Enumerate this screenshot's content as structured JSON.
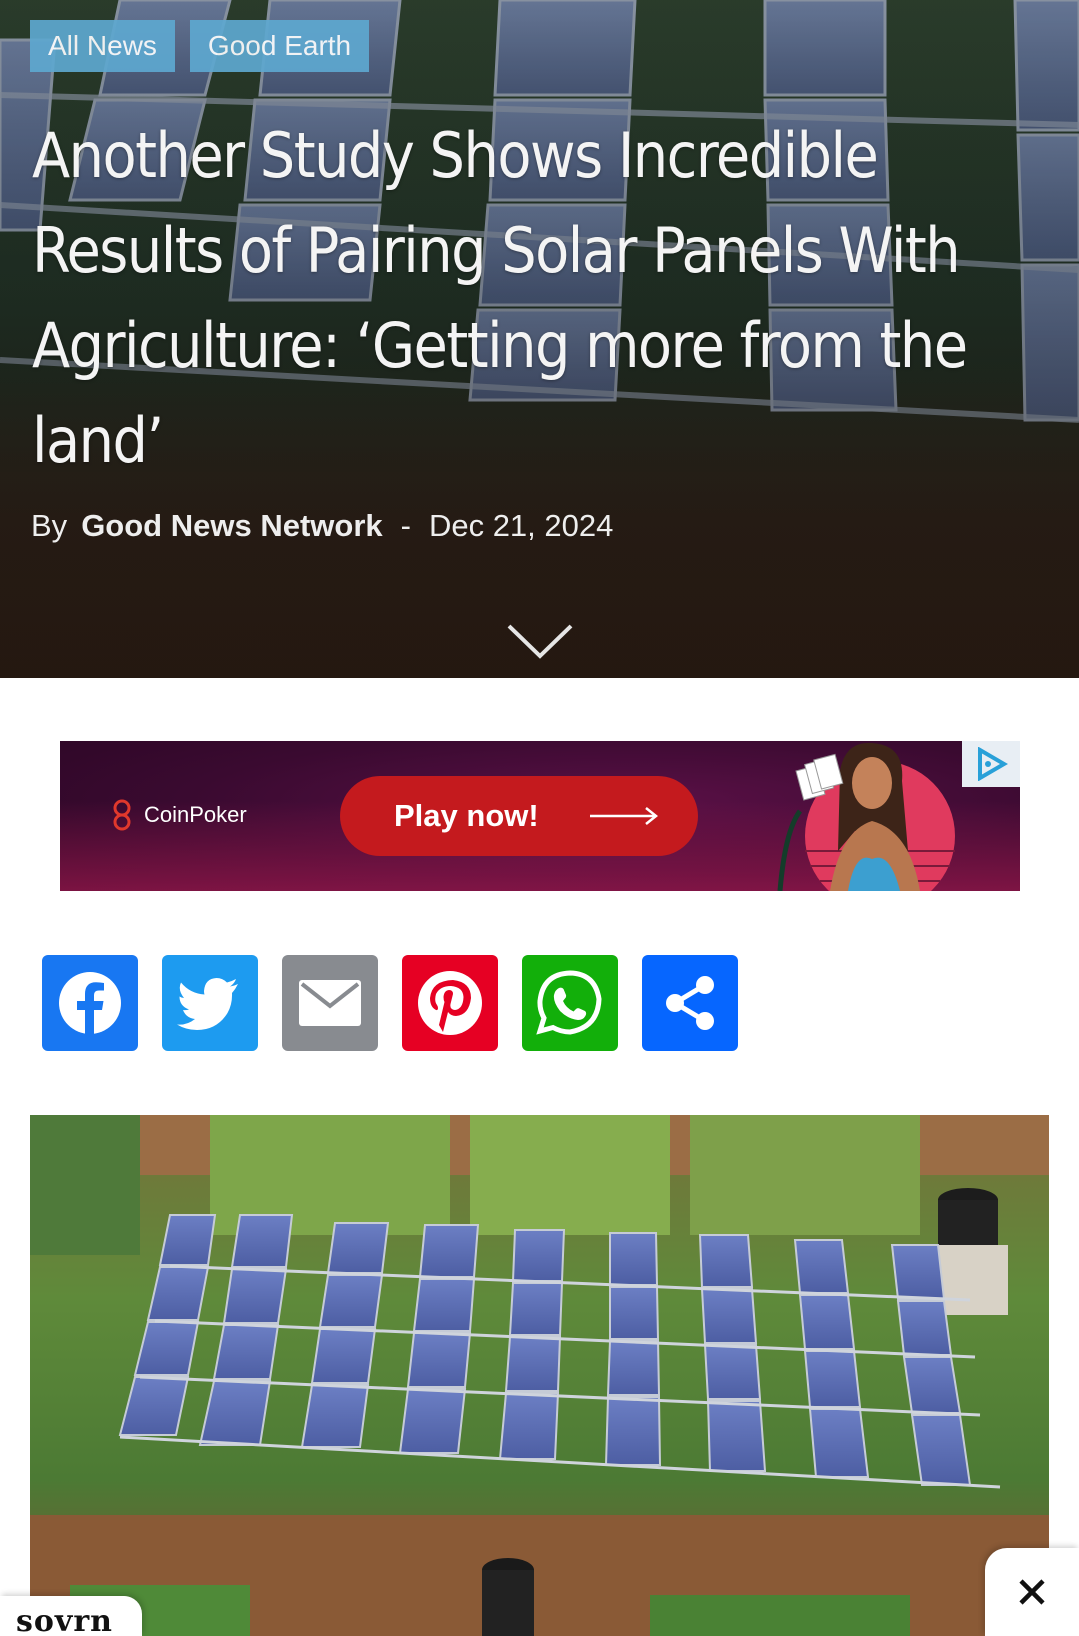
{
  "hero": {
    "tags": [
      "All News",
      "Good Earth"
    ],
    "headline": "Another Study Shows Incredible Results of Pairing Solar Panels With Agriculture: ‘Getting more from the land’",
    "byline": {
      "prefix": "By",
      "author": "Good News Network",
      "separator": "-",
      "date": "Dec 21, 2024"
    },
    "scroll_icon": "chevron-down-icon"
  },
  "ad": {
    "brand": "CoinPoker",
    "cta": "Play now!",
    "badge_icon": "adchoices-icon",
    "colors": {
      "background": "#3a0a30",
      "cta": "#c41a1e"
    }
  },
  "share": {
    "buttons": [
      {
        "name": "facebook",
        "icon": "facebook-icon",
        "color": "#1877f2"
      },
      {
        "name": "twitter",
        "icon": "twitter-icon",
        "color": "#1d9bf0"
      },
      {
        "name": "email",
        "icon": "email-icon",
        "color": "#888b90"
      },
      {
        "name": "pinterest",
        "icon": "pinterest-icon",
        "color": "#e60023"
      },
      {
        "name": "whatsapp",
        "icon": "whatsapp-icon",
        "color": "#12af0a"
      },
      {
        "name": "share",
        "icon": "share-icon",
        "color": "#0666ff"
      }
    ]
  },
  "overlays": {
    "logo": "sovrn",
    "close_icon": "close-icon"
  }
}
